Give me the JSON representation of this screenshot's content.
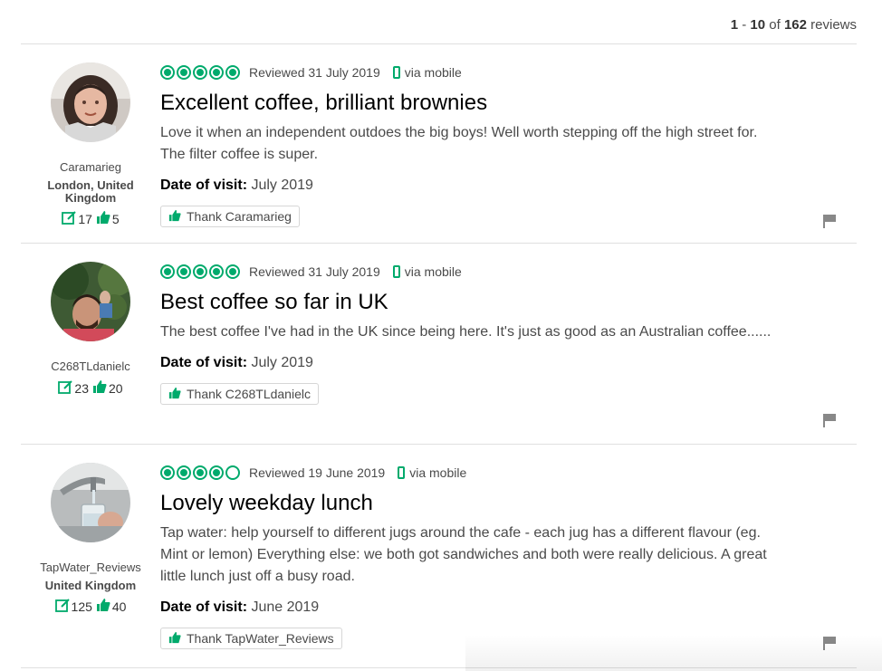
{
  "pager": {
    "start": "1",
    "dash": " - ",
    "end": "10",
    "of": " of ",
    "total": "162",
    "suffix": " reviews"
  },
  "colors": {
    "accent": "#00aa6c",
    "flag": "#888888"
  },
  "reviews": [
    {
      "username": "Caramarieg",
      "location": "London, United Kingdom",
      "review_count": "17",
      "helpful_count": "5",
      "rating": 5,
      "reviewed": "Reviewed 31 July 2019",
      "via": "via mobile",
      "title": "Excellent coffee, brilliant brownies",
      "body": "Love it when an independent outdoes the big boys! Well worth stepping off the high street for. The filter coffee is super.",
      "dov_label": "Date of visit:",
      "dov_value": " July 2019",
      "thank": "Thank Caramarieg"
    },
    {
      "username": "C268TLdanielc",
      "location": "",
      "review_count": "23",
      "helpful_count": "20",
      "rating": 5,
      "reviewed": "Reviewed 31 July 2019",
      "via": "via mobile",
      "title": "Best coffee so far in UK",
      "body": "The best coffee I've had in the UK since being here. It's just as good as an Australian coffee......",
      "dov_label": "Date of visit:",
      "dov_value": " July 2019",
      "thank": "Thank C268TLdanielc"
    },
    {
      "username": "TapWater_Reviews",
      "location": "United Kingdom",
      "review_count": "125",
      "helpful_count": "40",
      "rating": 4,
      "reviewed": "Reviewed 19 June 2019",
      "via": "via mobile",
      "title": "Lovely weekday lunch",
      "body": "Tap water: help yourself to different jugs around the cafe - each jug has a different flavour (eg. Mint or lemon) Everything else: we both got sandwiches and both were really delicious. A great little lunch just off a busy road.",
      "dov_label": "Date of visit:",
      "dov_value": " June 2019",
      "thank": "Thank TapWater_Reviews"
    }
  ]
}
